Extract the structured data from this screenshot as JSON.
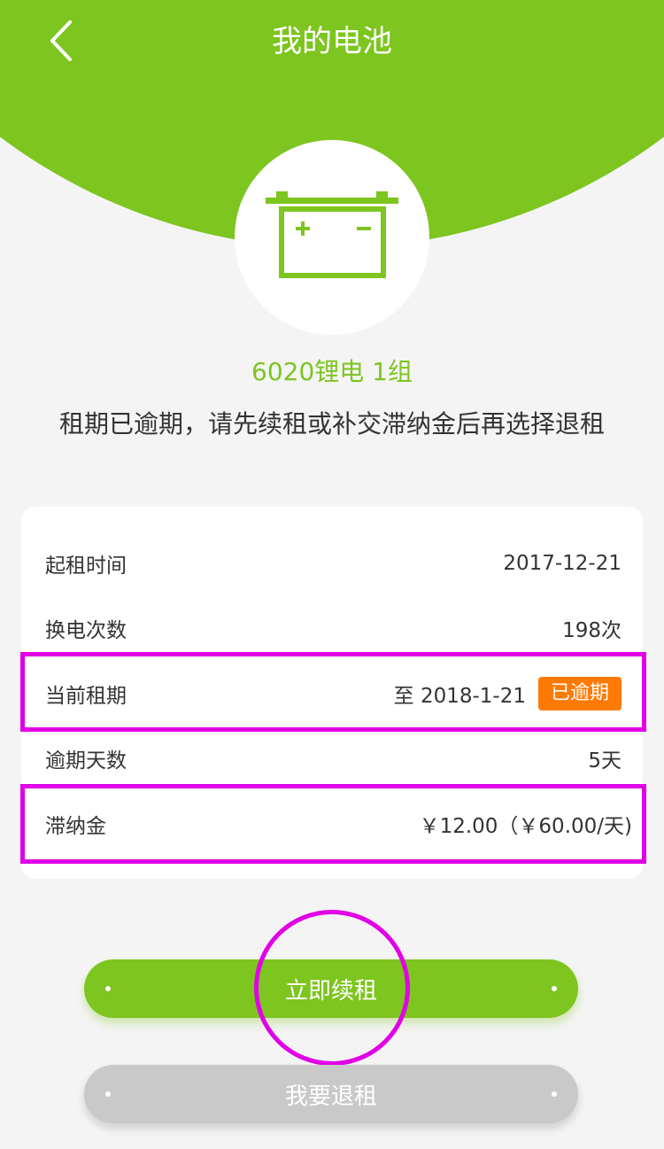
{
  "header": {
    "title": "我的电池",
    "back_icon": "chevron-left-icon",
    "background_color": "#7dc51f"
  },
  "battery": {
    "icon": "battery-icon",
    "product_name": "6020锂电 1组",
    "notice": "租期已逾期，请先续租或补交滞纳金后再选择退租"
  },
  "details": {
    "rows": [
      {
        "label": "起租时间",
        "value": "2017-12-21"
      },
      {
        "label": "换电次数",
        "value": "198次"
      },
      {
        "label": "当前租期",
        "value": "至 2018-1-21",
        "badge": "已逾期"
      },
      {
        "label": "逾期天数",
        "value": "5天"
      },
      {
        "label": "滞纳金",
        "value": "￥12.00（￥60.00/天)"
      }
    ]
  },
  "actions": {
    "renew_label": "立即续租",
    "return_label": "我要退租"
  },
  "colors": {
    "accent": "#7dc51f",
    "badge": "#ff7a00",
    "disabled": "#c9c9c9",
    "annotation": "#e100e6"
  }
}
